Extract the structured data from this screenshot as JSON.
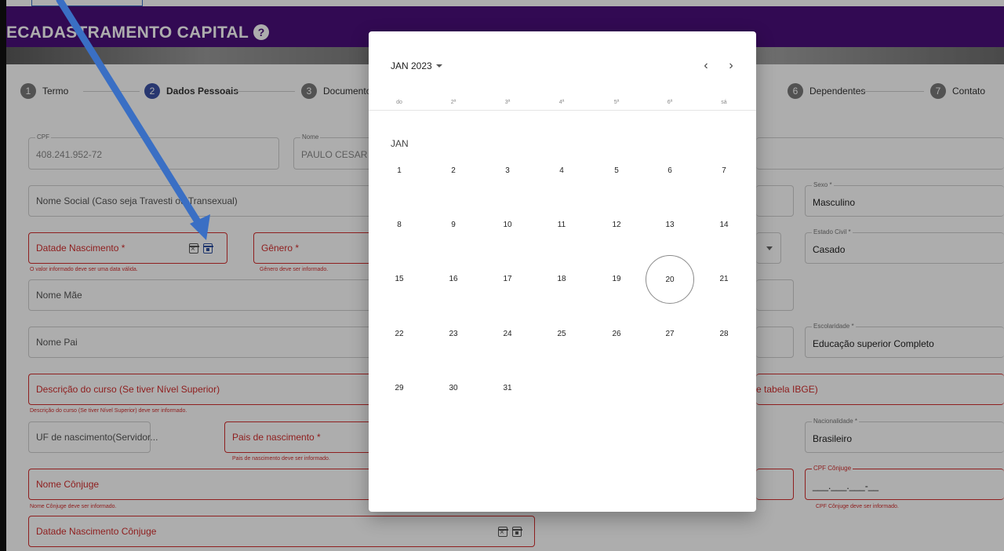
{
  "header": {
    "title": "ECADASTRAMENTO CAPITAL",
    "help_icon": "question-circle-icon",
    "bg_color": "#4a0f7b"
  },
  "stepper": [
    {
      "num": "1",
      "label": "Termo"
    },
    {
      "num": "2",
      "label": "Dados Pessoais",
      "active": true
    },
    {
      "num": "3",
      "label": "Documentos"
    },
    {
      "num": "6",
      "label": "Dependentes"
    },
    {
      "num": "7",
      "label": "Contato"
    }
  ],
  "form": {
    "cpf": {
      "label": "CPF",
      "value": "408.241.952-72"
    },
    "nome": {
      "label": "Nome",
      "value": "PAULO CESAR BEF"
    },
    "nome_social": {
      "placeholder": "Nome Social (Caso seja Travesti ou Transexual)"
    },
    "sexo": {
      "label": "Sexo *",
      "value": "Masculino"
    },
    "data_nascimento": {
      "placeholder": "Datade Nascimento *",
      "error": "O valor informado deve ser uma data válida."
    },
    "genero": {
      "placeholder": "Gênero *",
      "error": "Gênero deve ser informado."
    },
    "estado_civil": {
      "label": "Estado Civil *",
      "value": "Casado"
    },
    "nome_mae": {
      "placeholder": "Nome Mãe"
    },
    "nome_pai": {
      "placeholder": "Nome Pai"
    },
    "escolaridade": {
      "label": "Escolaridade *",
      "value": "Educação superior Completo"
    },
    "descricao_curso": {
      "placeholder": "Descrição do curso (Se tiver Nível Superior)",
      "error": "Descrição do curso (Se tiver Nível Superior) deve ser informado."
    },
    "ibge_fragment": "e tabela IBGE)",
    "uf_nascimento": {
      "placeholder": "UF de nascimento(Servidor..."
    },
    "pais_nascimento": {
      "placeholder": "Pais de nascimento *",
      "error": "Pais de nascimento deve ser informado."
    },
    "nacionalidade": {
      "label": "Nacionalidade *",
      "value": "Brasileiro"
    },
    "nome_conjuge": {
      "placeholder": "Nome Cônjuge",
      "error": "Nome Cônjuge deve ser informado."
    },
    "cpf_conjuge": {
      "label": "CPF Cônjuge",
      "value": "___.___.___-__",
      "error": "CPF Cônjuge deve ser informado."
    },
    "data_nascimento_conjuge": {
      "placeholder": "Datade Nascimento Cônjuge"
    }
  },
  "datepicker": {
    "month_year": "JAN 2023",
    "prev_label": "‹",
    "next_label": "›",
    "weekdays": [
      "do",
      "2ª",
      "3ª",
      "4ª",
      "5ª",
      "6ª",
      "sá"
    ],
    "month_label": "JAN",
    "days": [
      "1",
      "2",
      "3",
      "4",
      "5",
      "6",
      "7",
      "8",
      "9",
      "10",
      "11",
      "12",
      "13",
      "14",
      "15",
      "16",
      "17",
      "18",
      "19",
      "20",
      "21",
      "22",
      "23",
      "24",
      "25",
      "26",
      "27",
      "28",
      "29",
      "30",
      "31"
    ],
    "today": "20"
  },
  "annotation": {
    "arrow_color": "#3a6fc4"
  }
}
